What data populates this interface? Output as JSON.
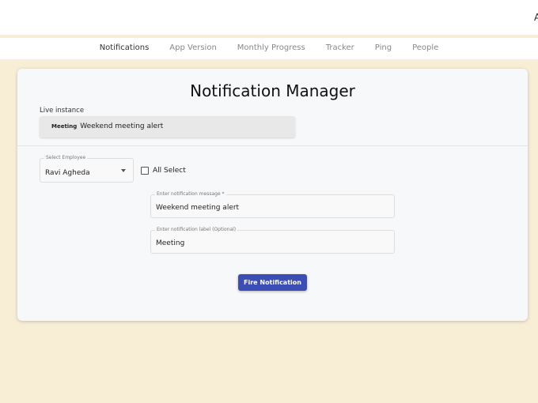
{
  "header": {
    "user_initial": "A"
  },
  "nav": {
    "items": [
      "Notifications",
      "App Version",
      "Monthly Progress",
      "Tracker",
      "Ping",
      "People"
    ],
    "active": "Notifications"
  },
  "card": {
    "title": "Notification Manager",
    "live_label": "Live instance",
    "live": {
      "label": "Meeting",
      "message": "Weekend meeting alert"
    },
    "employee": {
      "label": "Select Employee",
      "value": "Ravi Agheda"
    },
    "all_select": {
      "label": "All Select",
      "checked": false
    },
    "message_field": {
      "label": "Enter notification message *",
      "value": "Weekend meeting alert"
    },
    "label_field": {
      "label": "Enter notification label (Optional)",
      "value": "Meeting"
    },
    "button": "Fire Notification"
  },
  "colors": {
    "background": "#f8eed6",
    "button": "#3c4db5"
  }
}
